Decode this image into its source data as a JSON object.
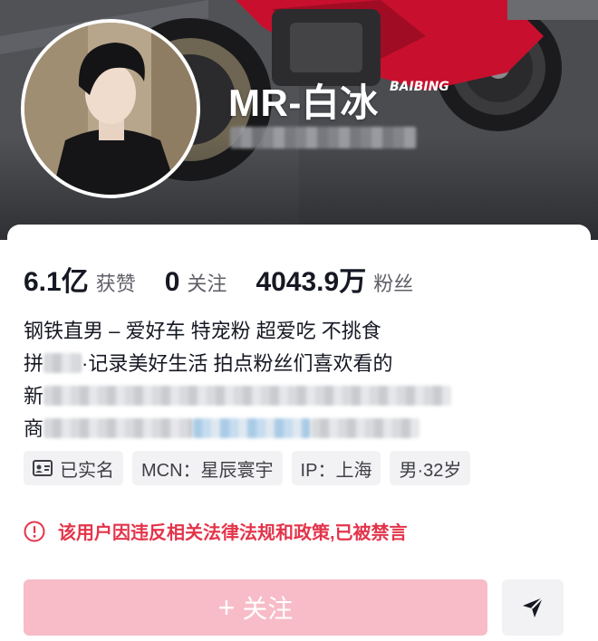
{
  "profile": {
    "nickname": "MR-白冰"
  },
  "stats": [
    {
      "value": "6.1亿",
      "label": "获赞"
    },
    {
      "value": "0",
      "label": "关注"
    },
    {
      "value": "4043.9万",
      "label": "粉丝"
    }
  ],
  "bio": {
    "line1": "钢铁直男 – 爱好车 特宠粉 超爱吃 不挑食",
    "line2_prefix": "拼",
    "line2_suffix": "·记录美好生活 拍点粉丝们喜欢看的",
    "line3_prefix": "新",
    "line4_prefix": "商"
  },
  "tags": [
    {
      "icon": "id-card-icon",
      "label": "已实名"
    },
    {
      "label": "MCN：星辰寰宇"
    },
    {
      "label": "IP：上海"
    },
    {
      "label": "男·32岁"
    }
  ],
  "ban_notice": {
    "icon": "alert-circle-icon",
    "text": "该用户因违反相关法律法规和政策,已被禁言"
  },
  "actions": {
    "follow_icon": "+",
    "follow_label": "关注",
    "share_icon": "send-icon"
  },
  "colors": {
    "ban_red": "#e3344a",
    "follow_pink": "#f7bcc7",
    "text_dark": "#161823"
  }
}
